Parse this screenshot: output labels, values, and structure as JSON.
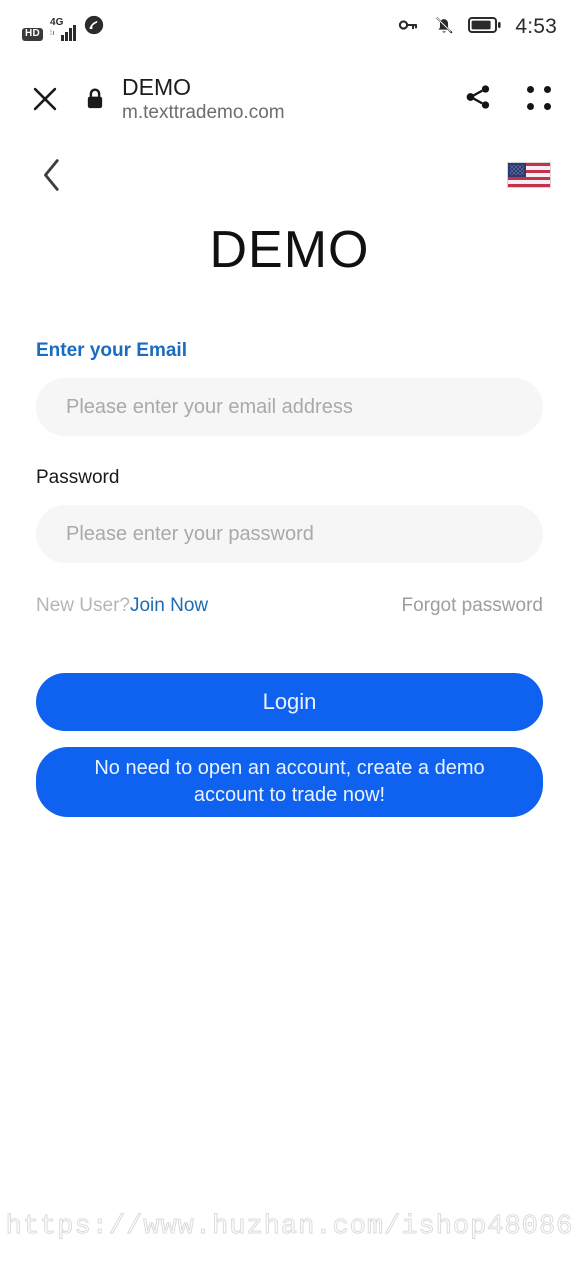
{
  "status_bar": {
    "hd_label": "HD",
    "network_label": "4G",
    "signal_icon": "signal-bars-icon",
    "hotspot_icon": "hotspot-icon",
    "vpn_key_icon": "key-icon",
    "mute_icon": "bell-muted-icon",
    "battery_icon": "battery-icon",
    "time": "4:53"
  },
  "browser": {
    "close_icon": "close-icon",
    "lock_icon": "lock-icon",
    "site_title": "DEMO",
    "site_url": "m.texttrademo.com",
    "share_icon": "share-icon",
    "menu_icon": "grid-menu-icon"
  },
  "page": {
    "back_icon": "chevron-left-icon",
    "language_flag": "us-flag-icon",
    "brand": "DEMO",
    "email": {
      "label": "Enter your Email",
      "placeholder": "Please enter your email address",
      "value": ""
    },
    "password": {
      "label": "Password",
      "placeholder": "Please enter your password",
      "value": ""
    },
    "helpers": {
      "new_user": "New User?",
      "join_now": "Join Now",
      "forgot_password": "Forgot password"
    },
    "buttons": {
      "login": "Login",
      "demo_account": "No need to open an account, create a demo account to trade now!"
    }
  },
  "watermark": "https://www.huzhan.com/ishop48086",
  "colors": {
    "primary_blue": "#0f62f0",
    "label_blue": "#1a6cc0",
    "link_blue": "#1f6bb3",
    "input_bg": "#f6f6f7",
    "placeholder": "#a9a9ad"
  }
}
